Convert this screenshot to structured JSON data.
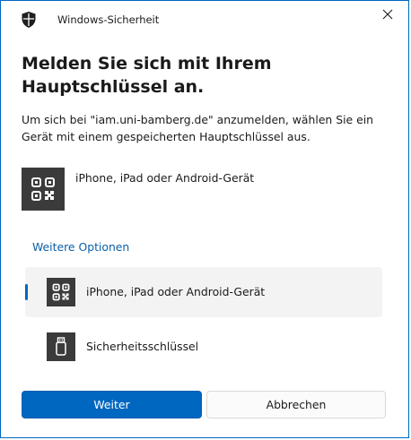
{
  "window": {
    "title": "Windows-Sicherheit",
    "icon": "shield-icon",
    "close_icon": "close-icon"
  },
  "dialog": {
    "heading": "Melden Sie sich mit Ihrem Hauptschlüssel an.",
    "description": "Um sich bei \"iam.uni-bamberg.de\" anzumelden, wählen Sie ein Gerät mit einem gespeicherten Hauptschlüssel aus.",
    "primary_option": {
      "label": "iPhone, iPad oder Android-Gerät",
      "icon": "qr-code-icon"
    },
    "more_options_label": "Weitere Optionen",
    "options": [
      {
        "label": "iPhone, iPad oder Android-Gerät",
        "icon": "qr-code-icon",
        "selected": true
      },
      {
        "label": "Sicherheitsschlüssel",
        "icon": "usb-key-icon",
        "selected": false
      }
    ]
  },
  "buttons": {
    "next": "Weiter",
    "cancel": "Abbrechen"
  },
  "colors": {
    "accent": "#0067c0",
    "link": "#0a5fa8",
    "icon_tile": "#3b3b3b",
    "selected_row": "#f3f3f3"
  }
}
